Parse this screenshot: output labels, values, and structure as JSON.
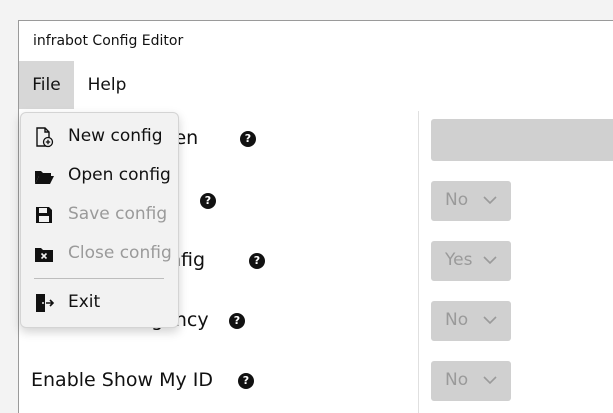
{
  "window": {
    "title": "infrabot Config Editor"
  },
  "menubar": {
    "file": "File",
    "help": "Help"
  },
  "file_menu": {
    "items": [
      {
        "label": "New config",
        "icon": "new-file-icon",
        "enabled": true
      },
      {
        "label": "Open config",
        "icon": "open-folder-icon",
        "enabled": true
      },
      {
        "label": "Save config",
        "icon": "save-icon",
        "enabled": false
      },
      {
        "label": "Close config",
        "icon": "close-file-icon",
        "enabled": false
      },
      {
        "label": "Exit",
        "icon": "exit-icon",
        "enabled": true
      }
    ]
  },
  "settings": {
    "rows": [
      {
        "label": "ten",
        "help": "?",
        "control": "text"
      },
      {
        "label": "",
        "help": "?",
        "control": "select",
        "value": "No"
      },
      {
        "label": "nfig",
        "help": "?",
        "control": "select",
        "value": "Yes"
      },
      {
        "label": "Enable emergency",
        "help": "?",
        "control": "select",
        "value": "No"
      },
      {
        "label": "Enable Show My ID",
        "help": "?",
        "control": "select",
        "value": "No"
      }
    ]
  },
  "colors": {
    "menu_highlight": "#d7d7d7",
    "control_bg": "#d0d0d0",
    "disabled_text": "#9a9a9a"
  }
}
